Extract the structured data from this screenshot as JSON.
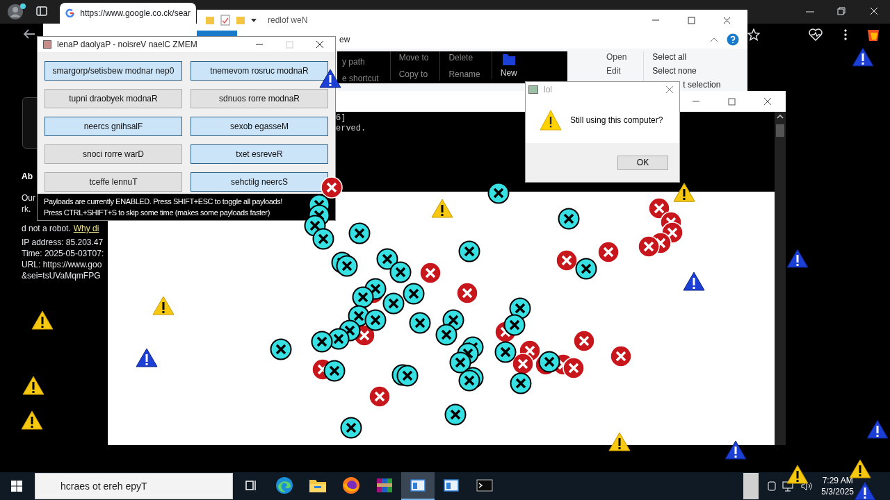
{
  "browser": {
    "tab_title": "https://www.google.co.ck/sear",
    "page": {
      "heading": "Ab",
      "lines": [
        "Our",
        "rk.",
        "d not a robot."
      ],
      "link": "Why di",
      "details": [
        "IP address: 85.203.47",
        "Time: 2025-05-03T07:",
        "URL: https://www.goo",
        "&sei=tsUVaMqmFPG"
      ]
    }
  },
  "explorer": {
    "title": "redlof weN",
    "tab": "ew",
    "clipboard": [
      "y path",
      "e shortcut"
    ],
    "organize": [
      "Move to",
      "Copy to",
      "Delete",
      "Rename"
    ],
    "new": "New",
    "open": [
      "Open",
      "Edit"
    ],
    "select": [
      "Select all",
      "Select none",
      "t selection"
    ]
  },
  "console": {
    "lines": [
      "6]",
      "erved."
    ]
  },
  "memz": {
    "title": "lenaP daolyaP - noisreV naelC ZMEM",
    "payloads": [
      {
        "label": "smargorp/setisbew modnar nep0",
        "on": true
      },
      {
        "label": "tnemevom rosruc modnaR",
        "on": true
      },
      {
        "label": "tupni draobyek modnaR",
        "on": false
      },
      {
        "label": "sdnuos rorre modnaR",
        "on": false
      },
      {
        "label": "neercs gnihsalF",
        "on": true
      },
      {
        "label": "sexob egasseM",
        "on": true
      },
      {
        "label": "snoci rorre warD",
        "on": false
      },
      {
        "label": "txet esreveR",
        "on": true
      },
      {
        "label": "tceffe lennuT",
        "on": false
      },
      {
        "label": "sehctilg neercS",
        "on": true
      }
    ],
    "status": [
      "Payloads are currently ENABLED. Press SHIFT+ESC to toggle all payloads!",
      "Press CTRL+SHIFT+S to skip some time (makes some payloads faster)"
    ]
  },
  "dialog": {
    "title": "lol",
    "message": "Still using this computer?",
    "button": "OK"
  },
  "taskbar": {
    "search_placeholder": "hcraes ot ereh epyT",
    "apps": [
      {
        "kind": "taskview",
        "selected": false
      },
      {
        "kind": "edge",
        "selected": false
      },
      {
        "kind": "explorer",
        "selected": false
      },
      {
        "kind": "firefox",
        "selected": false
      },
      {
        "kind": "archive",
        "selected": false
      },
      {
        "kind": "window",
        "selected": true
      },
      {
        "kind": "window",
        "selected": false
      },
      {
        "kind": "terminal",
        "selected": false
      }
    ],
    "time": "7:29 AM",
    "date": "5/3/2025"
  }
}
